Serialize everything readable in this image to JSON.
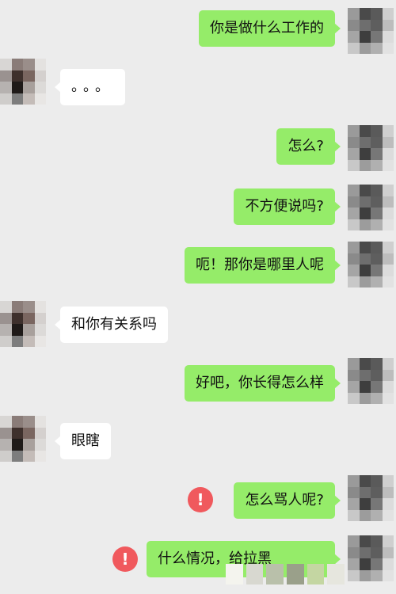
{
  "messages": [
    {
      "side": "sent",
      "text": "你是做什么工作的"
    },
    {
      "side": "recv",
      "text": "。。。"
    },
    {
      "side": "sent",
      "text": "怎么?"
    },
    {
      "side": "sent",
      "text": "不方便说吗?"
    },
    {
      "side": "sent",
      "text": "呃！那你是哪里人呢"
    },
    {
      "side": "recv",
      "text": "和你有关系吗"
    },
    {
      "side": "sent",
      "text": "好吧，你长得怎么样"
    },
    {
      "side": "recv",
      "text": "眼瞎"
    },
    {
      "side": "sent",
      "text": "怎么骂人呢?",
      "failed": true
    },
    {
      "side": "sent",
      "text": "什么情况，给拉黑",
      "failed": true
    }
  ],
  "error_icon": "!",
  "colors": {
    "background": "#ececec",
    "sent_bubble": "#95ec69",
    "received_bubble": "#ffffff",
    "error_badge": "#f0595d"
  },
  "icons": {
    "avatar_self": "pixelated-avatar-icon",
    "avatar_other": "pixelated-avatar-icon",
    "error": "exclamation-circle-icon"
  }
}
